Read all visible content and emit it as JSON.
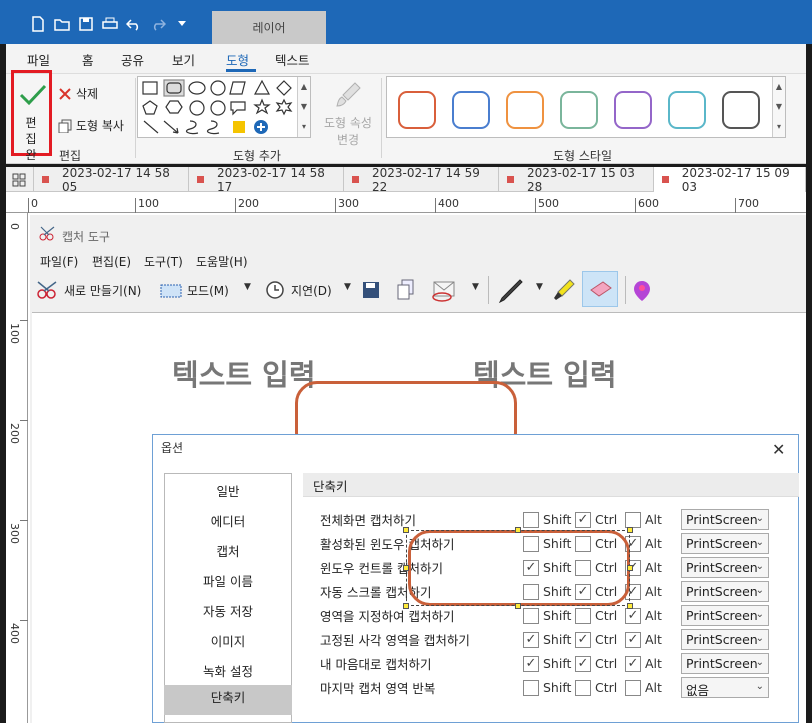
{
  "layer_tab": "레이어",
  "menu": {
    "items": [
      {
        "label": "파일",
        "key": "file"
      },
      {
        "label": "홈",
        "key": "home"
      },
      {
        "label": "공유",
        "key": "share"
      },
      {
        "label": "보기",
        "key": "view"
      },
      {
        "label": "도형",
        "key": "shape"
      },
      {
        "label": "텍스트",
        "key": "text"
      }
    ],
    "active": "도형"
  },
  "ribbon": {
    "edit_done": "편집 완료",
    "delete": "삭제",
    "copy_shape": "도형 복사",
    "group_edit": "편집",
    "group_add_shape": "도형 추가",
    "shape_props": "도형 속성 변경",
    "group_shape_style": "도형 스타일",
    "style_colors": [
      "#d95f3b",
      "#4a7ecf",
      "#ef9240",
      "#7ab59b",
      "#9466c9",
      "#5ab7c9",
      "#555555"
    ]
  },
  "tabs": [
    {
      "label": "2023-02-17 14 58 05"
    },
    {
      "label": "2023-02-17 14 58 17"
    },
    {
      "label": "2023-02-17 14 59 22"
    },
    {
      "label": "2023-02-17 15 03 28"
    },
    {
      "label": "2023-02-17 15 09 03",
      "active": true
    }
  ],
  "ruler": {
    "top": [
      "0",
      "100",
      "200",
      "300",
      "400",
      "500",
      "600",
      "700"
    ],
    "left": [
      "0",
      "100",
      "200",
      "300",
      "400"
    ]
  },
  "snip": {
    "title": "캡처 도구",
    "menu": [
      "파일(F)",
      "편집(E)",
      "도구(T)",
      "도움말(H)"
    ],
    "toolbar": {
      "new": "새로 만들기(N)",
      "mode": "모드(M)",
      "delay": "지연(D)"
    },
    "text1": "텍스트 입력",
    "text2": "텍스트 입력"
  },
  "dialog": {
    "title": "옵션",
    "nav": [
      "일반",
      "에디터",
      "캡처",
      "파일 이름",
      "자동 저장",
      "이미지",
      "녹화 설정",
      "단축키"
    ],
    "section": "단축키",
    "mod_labels": {
      "shift": "Shift",
      "ctrl": "Ctrl",
      "alt": "Alt"
    },
    "rows": [
      {
        "label": "전체화면 캡처하기",
        "shift": false,
        "ctrl": true,
        "alt": false,
        "key": "PrintScreen"
      },
      {
        "label": "활성화된 윈도우 캡처하기",
        "shift": false,
        "ctrl": false,
        "alt": true,
        "key": "PrintScreen"
      },
      {
        "label": "윈도우 컨트롤 캡처하기",
        "shift": true,
        "ctrl": false,
        "alt": true,
        "key": "PrintScreen"
      },
      {
        "label": "자동 스크롤 캡처하기",
        "shift": false,
        "ctrl": true,
        "alt": true,
        "key": "PrintScreen"
      },
      {
        "label": "영역을 지정하여 캡처하기",
        "shift": false,
        "ctrl": false,
        "alt": true,
        "key": "PrintScreen"
      },
      {
        "label": "고정된 사각 영역을 캡처하기",
        "shift": true,
        "ctrl": true,
        "alt": true,
        "key": "PrintScreen"
      },
      {
        "label": "내 마음대로 캡처하기",
        "shift": true,
        "ctrl": true,
        "alt": true,
        "key": "PrintScreen"
      },
      {
        "label": "마지막 캡처 영역 반복",
        "shift": false,
        "ctrl": false,
        "alt": false,
        "key": "없음"
      }
    ]
  }
}
